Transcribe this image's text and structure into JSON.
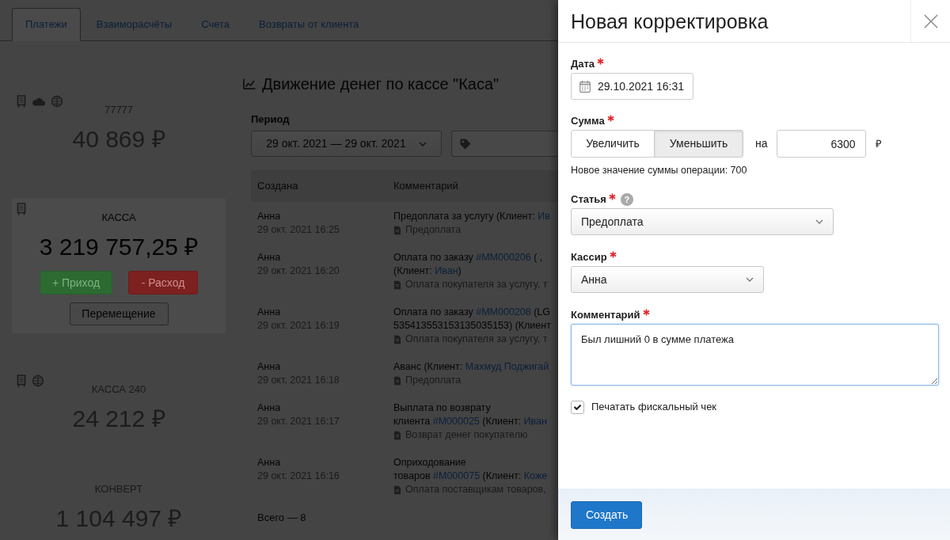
{
  "tabs": [
    {
      "label": "Платежи",
      "selected": true
    },
    {
      "label": "Взаиморасчёты",
      "selected": false
    },
    {
      "label": "Счета",
      "selected": false
    },
    {
      "label": "Возвраты от клиента",
      "selected": false
    }
  ],
  "accounts": [
    {
      "icons": [
        {
          "kind": "receipt"
        },
        {
          "kind": "cloud"
        },
        {
          "kind": "globe"
        }
      ],
      "name": "77777",
      "amount": "40 869 ₽",
      "selected": false
    },
    {
      "icons": [
        {
          "kind": "receipt"
        }
      ],
      "name": "КАССА",
      "amount": "3 219 757,25 ₽",
      "selected": true,
      "actions": [
        {
          "label": "+ Приход",
          "kind": "income"
        },
        {
          "label": "- Расход",
          "kind": "expense"
        },
        {
          "label": "Перемещение",
          "kind": "transfer"
        }
      ]
    },
    {
      "icons": [
        {
          "kind": "receipt"
        },
        {
          "kind": "globe"
        }
      ],
      "name": "КАССА 240",
      "amount": "24 212 ₽",
      "selected": false
    },
    {
      "name": "КОНВЕРТ",
      "amount": "1 104 497 ₽",
      "selected": false
    }
  ],
  "cash_flow": {
    "title": "Движение денег по кассе \"Каса\"",
    "period": {
      "label": "Период",
      "value": "29 окт. 2021 — 29 окт. 2021"
    },
    "table": {
      "columns": [
        "Создана",
        "Комментарий"
      ],
      "rows": [
        {
          "author": "Анна",
          "created": "29 окт. 2021 16:25",
          "comment_lines": [
            [
              {
                "kind": "text",
                "text": "Предоплата за услугу (Клиент: "
              },
              {
                "kind": "link",
                "text": "Ив"
              }
            ]
          ],
          "category": "Предоплата"
        },
        {
          "author": "Анна",
          "created": "29 окт. 2021 16:20",
          "comment_lines": [
            [
              {
                "kind": "text",
                "text": "Оплата по заказу "
              },
              {
                "kind": "link",
                "text": "#MM000206"
              },
              {
                "kind": "text",
                "text": " ( ,"
              }
            ],
            [
              {
                "kind": "text",
                "text": "(Клиент: "
              },
              {
                "kind": "link",
                "text": "Иван"
              },
              {
                "kind": "text",
                "text": ")"
              }
            ]
          ],
          "category": "Оплата покупателя за услугу, т"
        },
        {
          "author": "Анна",
          "created": "29 окт. 2021 16:19",
          "comment_lines": [
            [
              {
                "kind": "text",
                "text": "Оплата по заказу "
              },
              {
                "kind": "link",
                "text": "#MM000208"
              },
              {
                "kind": "text",
                "text": " (LG"
              }
            ],
            [
              {
                "kind": "text",
                "text": "535413553153135035153) (Клиент"
              }
            ]
          ],
          "category": "Оплата покупателя за услугу, т"
        },
        {
          "author": "Анна",
          "created": "29 окт. 2021 16:18",
          "comment_lines": [
            [
              {
                "kind": "text",
                "text": "Аванс (Клиент: "
              },
              {
                "kind": "link",
                "text": "Махмуд Поджигай"
              }
            ]
          ],
          "category": "Предоплата"
        },
        {
          "author": "Анна",
          "created": "29 окт. 2021 16:17",
          "comment_lines": [
            [
              {
                "kind": "text",
                "text": "Выплата по возврату"
              }
            ],
            [
              {
                "kind": "text",
                "text": "клиента "
              },
              {
                "kind": "link",
                "text": "#M000025"
              },
              {
                "kind": "text",
                "text": " (Клиент: "
              },
              {
                "kind": "link",
                "text": "Иван"
              }
            ]
          ],
          "category": "Возврат денег покупателю"
        },
        {
          "author": "Анна",
          "created": "29 окт. 2021 16:16",
          "comment_lines": [
            [
              {
                "kind": "text",
                "text": "Оприходование"
              }
            ],
            [
              {
                "kind": "text",
                "text": "товаров "
              },
              {
                "kind": "link",
                "text": "#M000075"
              },
              {
                "kind": "text",
                "text": " (Клиент: "
              },
              {
                "kind": "link",
                "text": "Коже"
              }
            ]
          ],
          "category": "Оплата поставщикам товаров,"
        }
      ],
      "total": "Всего — 8"
    }
  },
  "correction_panel": {
    "title": "Новая корректировка",
    "fields": [
      {
        "kind": "date",
        "label": "Дата",
        "required": true,
        "value": "29.10.2021 16:31"
      },
      {
        "kind": "amount",
        "label": "Сумма",
        "required": true,
        "options": [
          {
            "label": "Увеличить",
            "selected": false
          },
          {
            "label": "Уменьшить",
            "selected": true
          }
        ],
        "connector": "на",
        "value": "6300",
        "currency": "₽",
        "note": "Новое значение суммы операции: 700"
      },
      {
        "kind": "select",
        "label": "Статья",
        "required": true,
        "help": "?",
        "value": "Предоплата"
      },
      {
        "kind": "select",
        "label": "Кассир",
        "required": true,
        "value": "Анна"
      },
      {
        "kind": "textarea",
        "label": "Комментарий",
        "required": true,
        "value": "Был лишний 0 в сумме платежа",
        "focused": true
      },
      {
        "kind": "checkbox",
        "label": "Печатать фискальный чек",
        "checked": true
      }
    ],
    "submit": "Создать"
  }
}
